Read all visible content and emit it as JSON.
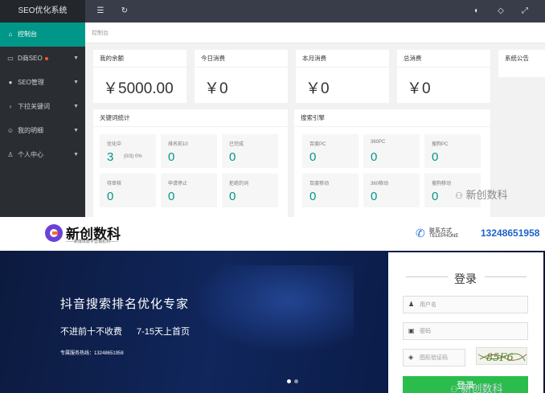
{
  "admin": {
    "app_title": "SEO优化系统",
    "sidebar": [
      {
        "label": "控制台",
        "icon": "home-icon",
        "glyph": "⌂"
      },
      {
        "label": "D商SEO",
        "icon": "monitor-icon",
        "glyph": "▭"
      },
      {
        "label": "SEO管理",
        "icon": "circle-icon",
        "glyph": "●"
      },
      {
        "label": "下拉关键词",
        "icon": "arrow-right-icon",
        "glyph": "›"
      },
      {
        "label": "我的明细",
        "icon": "smile-icon",
        "glyph": "☺"
      },
      {
        "label": "个人中心",
        "icon": "user-icon",
        "glyph": "♙"
      }
    ],
    "toolbar": {
      "menu_glyph": "☰",
      "refresh_glyph": "↻",
      "theme_glyph": "◐",
      "tag_glyph": "◇",
      "fullscreen_glyph": "⤢"
    },
    "breadcrumb": "控制台",
    "stats": [
      {
        "label": "我的余额",
        "value": "￥5000.00"
      },
      {
        "label": "今日消费",
        "value": "￥0"
      },
      {
        "label": "本月消费",
        "value": "￥0"
      },
      {
        "label": "总消费",
        "value": "￥0"
      }
    ],
    "notice_title": "系统公告",
    "keyword_stats": {
      "title": "关键词统计",
      "cells": [
        {
          "label": "优化中",
          "value": "3",
          "extra": "(0/3) 0%"
        },
        {
          "label": "排名前10",
          "value": "0"
        },
        {
          "label": "已完成",
          "value": "0"
        },
        {
          "label": "待审核",
          "value": "0"
        },
        {
          "label": "申请停止",
          "value": "0"
        },
        {
          "label": "拒绝的词",
          "value": "0"
        }
      ]
    },
    "search_engines": {
      "title": "搜索引擎",
      "cells": [
        {
          "label": "百度PC",
          "value": "0"
        },
        {
          "label": "360PC",
          "value": "0"
        },
        {
          "label": "搜狗PC",
          "value": "0"
        },
        {
          "label": "百度移动",
          "value": "0"
        },
        {
          "label": "360移动",
          "value": "0"
        },
        {
          "label": "搜狗移动",
          "value": "0"
        }
      ]
    },
    "watermark": "新创数科"
  },
  "site": {
    "brand": "新创数科",
    "brand_sub": "——新媒体数字营销机构——",
    "contact_label": "联系方式",
    "contact_label_en": "TELEPHONE",
    "phone": "13248651958",
    "banner_title": "抖音搜索排名优化专家",
    "banner_line2a": "不进前十不收费",
    "banner_line2b": "7-15天上首页",
    "banner_line3": "专属服务热线：13248651958",
    "login": {
      "title": "登录",
      "username_placeholder": "用户名",
      "password_placeholder": "密码",
      "captcha_placeholder": "图形验证码",
      "captcha_text": "85F6",
      "submit": "登录"
    },
    "watermark": "新创数科"
  },
  "colors": {
    "accent": "#009688",
    "sidebar": "#2a2d32",
    "topbar": "#393d49",
    "login_button": "#2bbd4c",
    "phone": "#1c63c6"
  }
}
